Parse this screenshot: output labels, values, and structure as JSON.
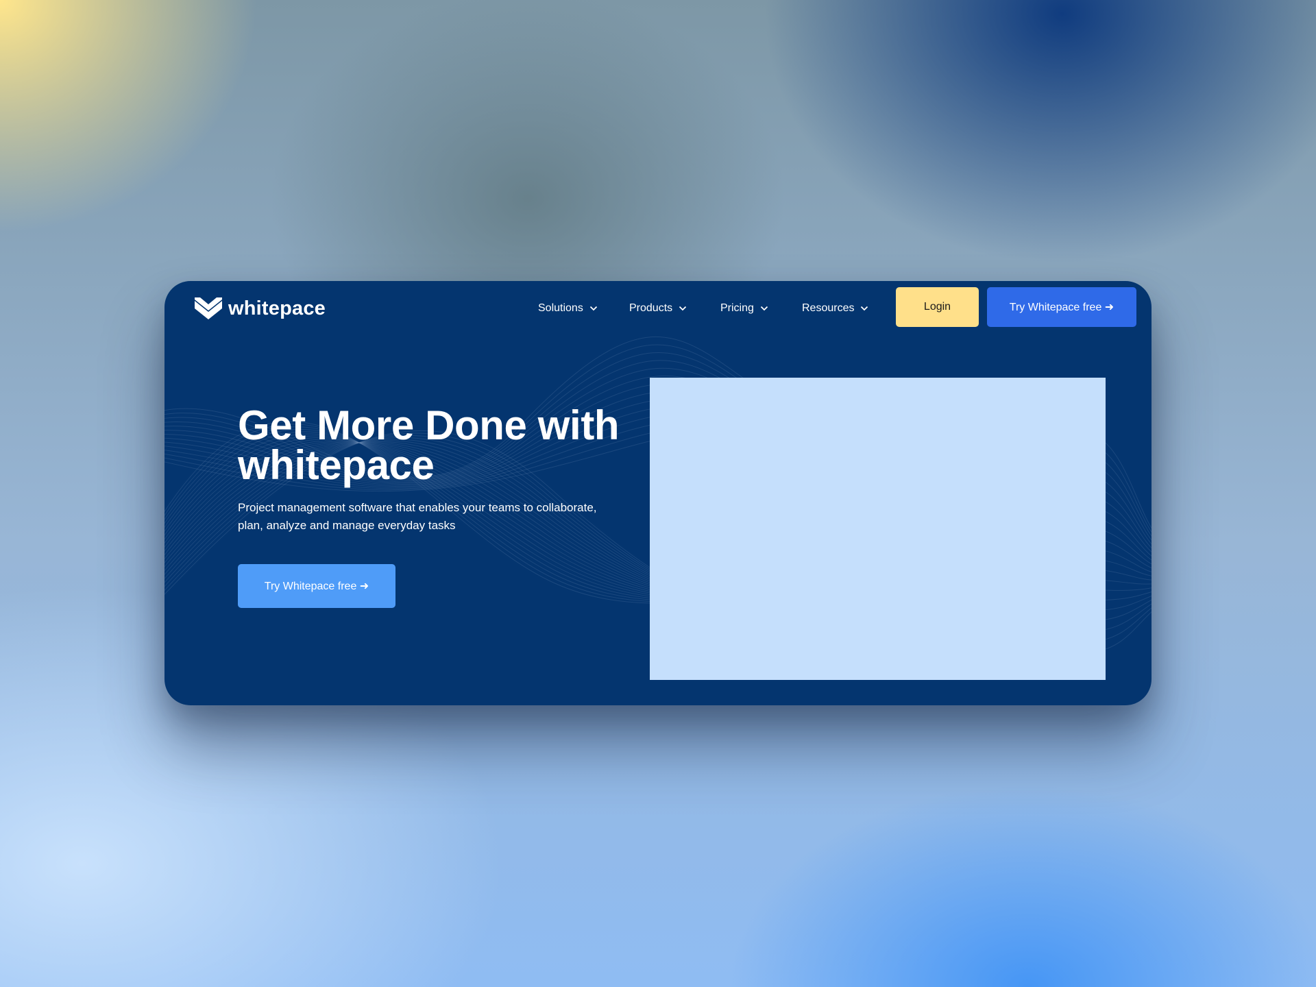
{
  "brand": {
    "name": "whitepace",
    "logo_icon": "whitepace-logo-icon"
  },
  "nav": {
    "items": [
      {
        "label": "Solutions"
      },
      {
        "label": "Products"
      },
      {
        "label": "Pricing"
      },
      {
        "label": "Resources"
      }
    ],
    "login_label": "Login",
    "cta_label": "Try Whitepace free ➜"
  },
  "hero": {
    "title": "Get More Done with whitepace",
    "subtitle": "Project management software that enables your teams to collaborate, plan, analyze and manage everyday tasks",
    "cta_label": "Try Whitepace free ➜"
  },
  "colors": {
    "card_background": "#04356f",
    "login_button": "#ffe08a",
    "nav_cta_button": "#2f6ae8",
    "hero_cta_button": "#4f9cf8",
    "hero_visual": "#c5dffc"
  }
}
